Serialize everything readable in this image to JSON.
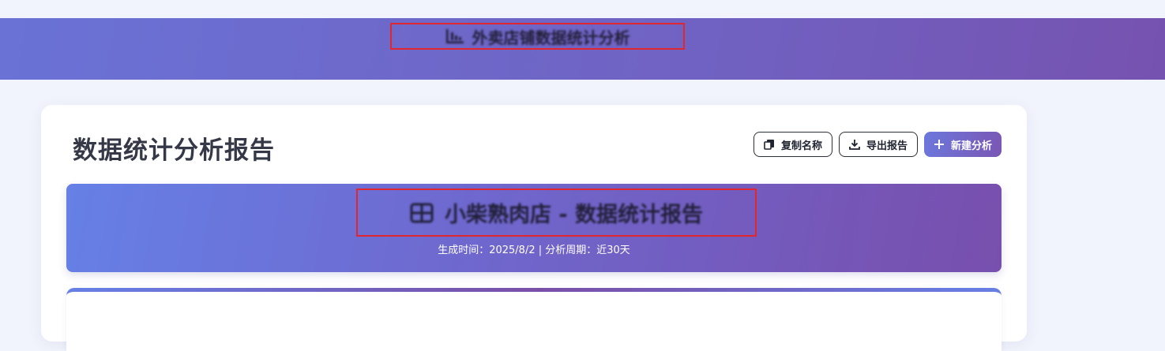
{
  "header": {
    "title": "外卖店铺数据统计分析",
    "icon": "bar-chart-icon",
    "background": "#6f66c6"
  },
  "report": {
    "page_title": "数据统计分析报告",
    "actions": {
      "copy_label": "复制名称",
      "export_label": "导出报告",
      "new_label": "新建分析"
    },
    "banner": {
      "icon": "table-icon",
      "title": "小柴熟肉店 - 数据统计报告",
      "subtitle": "生成时间：2025/8/2 | 分析周期：近30天"
    }
  },
  "colors": {
    "accent_start": "#6680e6",
    "accent_end": "#784fad",
    "highlight_border": "#e0262e"
  }
}
